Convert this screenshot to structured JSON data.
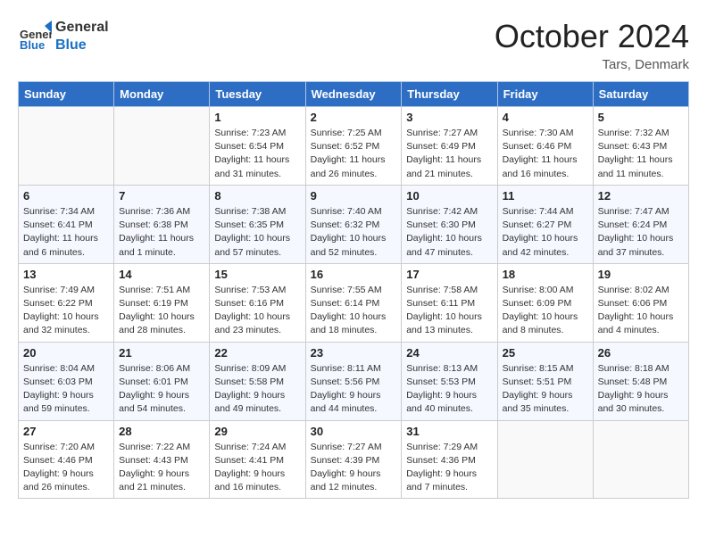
{
  "header": {
    "logo_general": "General",
    "logo_blue": "Blue",
    "month_title": "October 2024",
    "location": "Tars, Denmark"
  },
  "weekdays": [
    "Sunday",
    "Monday",
    "Tuesday",
    "Wednesday",
    "Thursday",
    "Friday",
    "Saturday"
  ],
  "weeks": [
    [
      {
        "day": "",
        "info": ""
      },
      {
        "day": "",
        "info": ""
      },
      {
        "day": "1",
        "info": "Sunrise: 7:23 AM\nSunset: 6:54 PM\nDaylight: 11 hours and 31 minutes."
      },
      {
        "day": "2",
        "info": "Sunrise: 7:25 AM\nSunset: 6:52 PM\nDaylight: 11 hours and 26 minutes."
      },
      {
        "day": "3",
        "info": "Sunrise: 7:27 AM\nSunset: 6:49 PM\nDaylight: 11 hours and 21 minutes."
      },
      {
        "day": "4",
        "info": "Sunrise: 7:30 AM\nSunset: 6:46 PM\nDaylight: 11 hours and 16 minutes."
      },
      {
        "day": "5",
        "info": "Sunrise: 7:32 AM\nSunset: 6:43 PM\nDaylight: 11 hours and 11 minutes."
      }
    ],
    [
      {
        "day": "6",
        "info": "Sunrise: 7:34 AM\nSunset: 6:41 PM\nDaylight: 11 hours and 6 minutes."
      },
      {
        "day": "7",
        "info": "Sunrise: 7:36 AM\nSunset: 6:38 PM\nDaylight: 11 hours and 1 minute."
      },
      {
        "day": "8",
        "info": "Sunrise: 7:38 AM\nSunset: 6:35 PM\nDaylight: 10 hours and 57 minutes."
      },
      {
        "day": "9",
        "info": "Sunrise: 7:40 AM\nSunset: 6:32 PM\nDaylight: 10 hours and 52 minutes."
      },
      {
        "day": "10",
        "info": "Sunrise: 7:42 AM\nSunset: 6:30 PM\nDaylight: 10 hours and 47 minutes."
      },
      {
        "day": "11",
        "info": "Sunrise: 7:44 AM\nSunset: 6:27 PM\nDaylight: 10 hours and 42 minutes."
      },
      {
        "day": "12",
        "info": "Sunrise: 7:47 AM\nSunset: 6:24 PM\nDaylight: 10 hours and 37 minutes."
      }
    ],
    [
      {
        "day": "13",
        "info": "Sunrise: 7:49 AM\nSunset: 6:22 PM\nDaylight: 10 hours and 32 minutes."
      },
      {
        "day": "14",
        "info": "Sunrise: 7:51 AM\nSunset: 6:19 PM\nDaylight: 10 hours and 28 minutes."
      },
      {
        "day": "15",
        "info": "Sunrise: 7:53 AM\nSunset: 6:16 PM\nDaylight: 10 hours and 23 minutes."
      },
      {
        "day": "16",
        "info": "Sunrise: 7:55 AM\nSunset: 6:14 PM\nDaylight: 10 hours and 18 minutes."
      },
      {
        "day": "17",
        "info": "Sunrise: 7:58 AM\nSunset: 6:11 PM\nDaylight: 10 hours and 13 minutes."
      },
      {
        "day": "18",
        "info": "Sunrise: 8:00 AM\nSunset: 6:09 PM\nDaylight: 10 hours and 8 minutes."
      },
      {
        "day": "19",
        "info": "Sunrise: 8:02 AM\nSunset: 6:06 PM\nDaylight: 10 hours and 4 minutes."
      }
    ],
    [
      {
        "day": "20",
        "info": "Sunrise: 8:04 AM\nSunset: 6:03 PM\nDaylight: 9 hours and 59 minutes."
      },
      {
        "day": "21",
        "info": "Sunrise: 8:06 AM\nSunset: 6:01 PM\nDaylight: 9 hours and 54 minutes."
      },
      {
        "day": "22",
        "info": "Sunrise: 8:09 AM\nSunset: 5:58 PM\nDaylight: 9 hours and 49 minutes."
      },
      {
        "day": "23",
        "info": "Sunrise: 8:11 AM\nSunset: 5:56 PM\nDaylight: 9 hours and 44 minutes."
      },
      {
        "day": "24",
        "info": "Sunrise: 8:13 AM\nSunset: 5:53 PM\nDaylight: 9 hours and 40 minutes."
      },
      {
        "day": "25",
        "info": "Sunrise: 8:15 AM\nSunset: 5:51 PM\nDaylight: 9 hours and 35 minutes."
      },
      {
        "day": "26",
        "info": "Sunrise: 8:18 AM\nSunset: 5:48 PM\nDaylight: 9 hours and 30 minutes."
      }
    ],
    [
      {
        "day": "27",
        "info": "Sunrise: 7:20 AM\nSunset: 4:46 PM\nDaylight: 9 hours and 26 minutes."
      },
      {
        "day": "28",
        "info": "Sunrise: 7:22 AM\nSunset: 4:43 PM\nDaylight: 9 hours and 21 minutes."
      },
      {
        "day": "29",
        "info": "Sunrise: 7:24 AM\nSunset: 4:41 PM\nDaylight: 9 hours and 16 minutes."
      },
      {
        "day": "30",
        "info": "Sunrise: 7:27 AM\nSunset: 4:39 PM\nDaylight: 9 hours and 12 minutes."
      },
      {
        "day": "31",
        "info": "Sunrise: 7:29 AM\nSunset: 4:36 PM\nDaylight: 9 hours and 7 minutes."
      },
      {
        "day": "",
        "info": ""
      },
      {
        "day": "",
        "info": ""
      }
    ]
  ]
}
